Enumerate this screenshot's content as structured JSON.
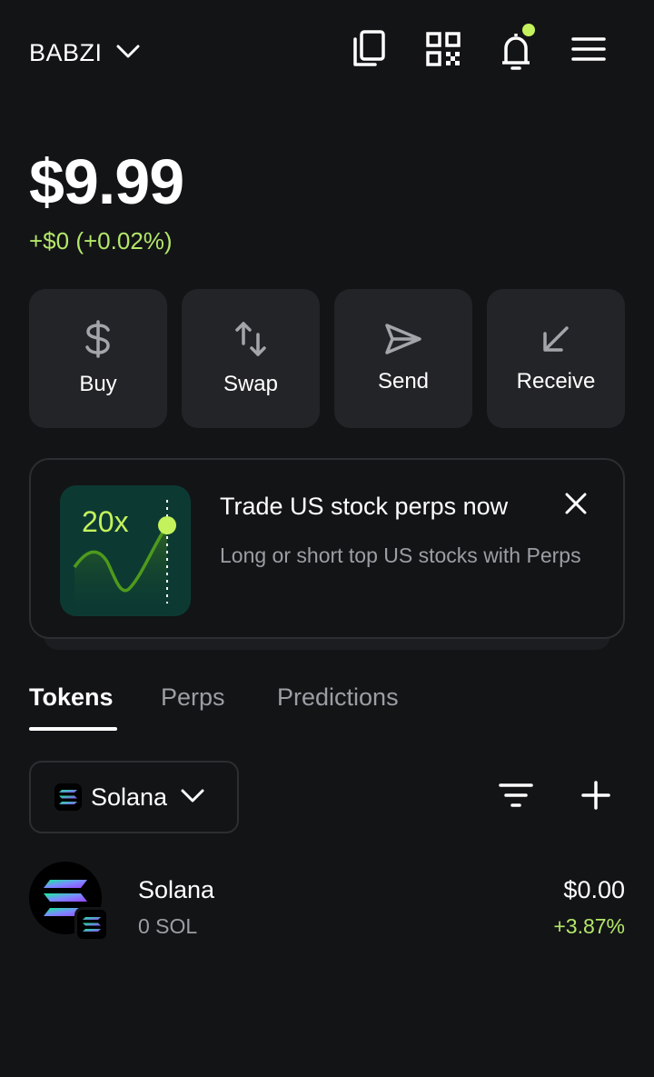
{
  "header": {
    "account_name": "BABZI"
  },
  "balance": {
    "total": "$9.99",
    "change": "+$0 (+0.02%)"
  },
  "actions": [
    {
      "label": "Buy",
      "icon": "dollar-icon"
    },
    {
      "label": "Swap",
      "icon": "swap-arrows-icon"
    },
    {
      "label": "Send",
      "icon": "send-icon"
    },
    {
      "label": "Receive",
      "icon": "receive-arrow-icon"
    }
  ],
  "promo": {
    "multiplier": "20x",
    "title": "Trade US stock perps now",
    "description": "Long or short top US stocks with Perps"
  },
  "tabs": [
    {
      "label": "Tokens",
      "active": true
    },
    {
      "label": "Perps",
      "active": false
    },
    {
      "label": "Predictions",
      "active": false
    }
  ],
  "network_filter": {
    "selected": "Solana"
  },
  "tokens": [
    {
      "name": "Solana",
      "amount": "0 SOL",
      "value": "$0.00",
      "change": "+3.87%"
    }
  ],
  "colors": {
    "background": "#131416",
    "card": "#232427",
    "accent_green": "#c4f25c",
    "positive": "#b3e76a",
    "muted_text": "#9c9ea4"
  }
}
